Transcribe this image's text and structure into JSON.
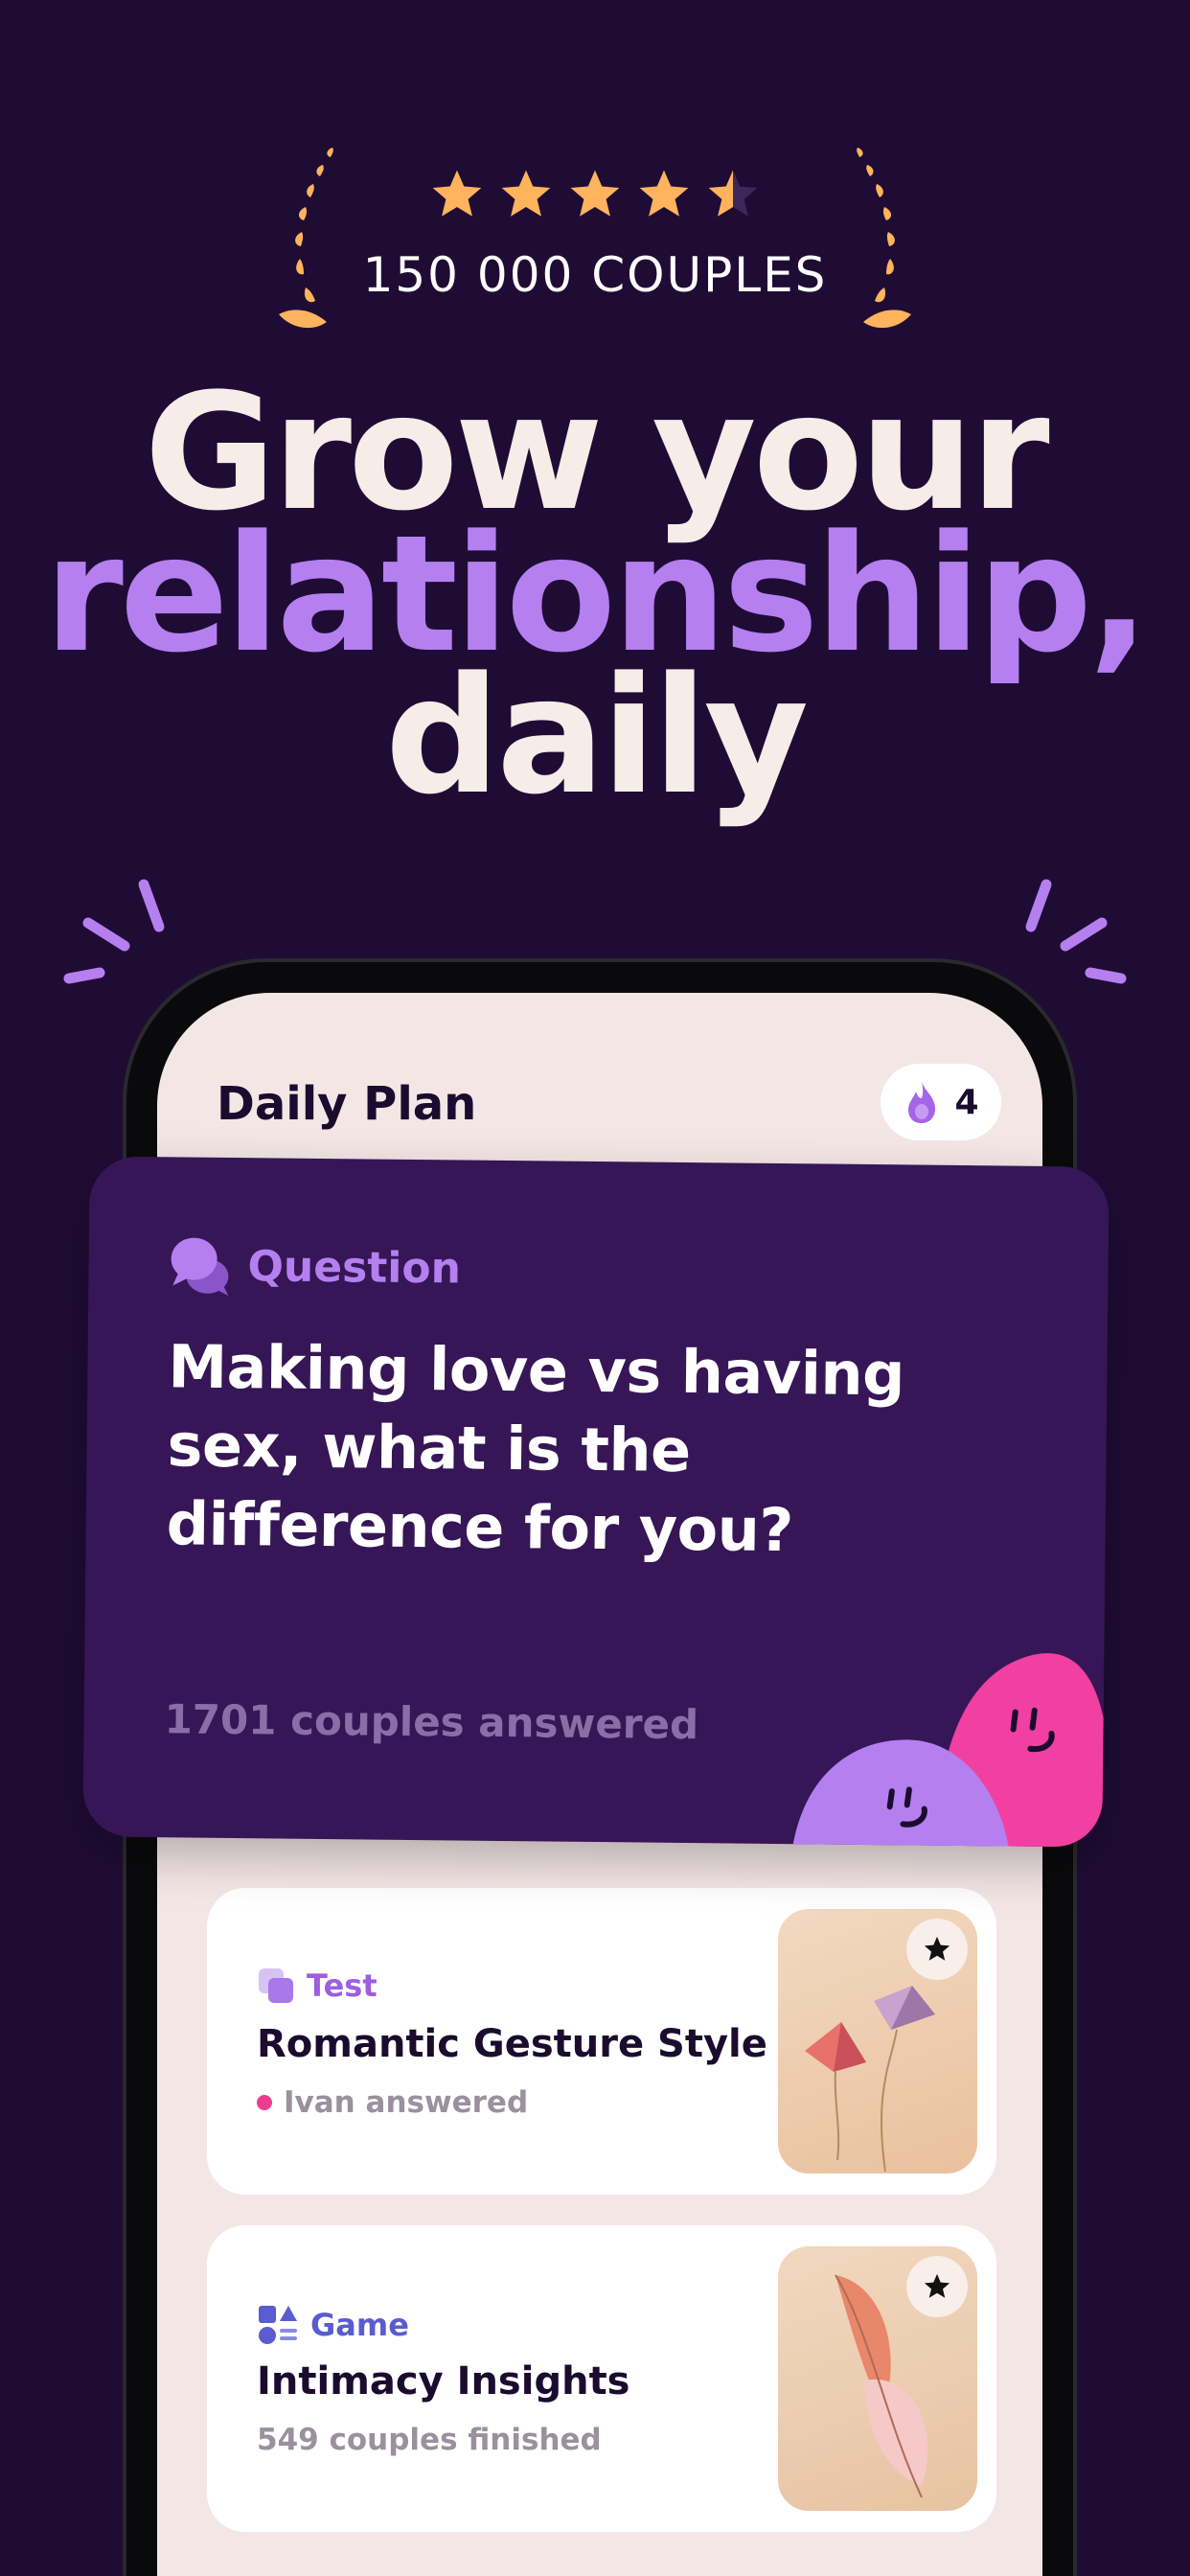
{
  "rating": {
    "stars_value": 4.5,
    "stars_max": 5,
    "count_text": "150 000 COUPLES",
    "star_color": "#ffb35c",
    "laurel_color": "#ffb35c"
  },
  "headline": {
    "line1": "Grow your",
    "line2": "relationship,",
    "line3": "daily",
    "accent_color": "#b57ff0"
  },
  "screen": {
    "title": "Daily Plan",
    "streak": {
      "icon": "flame-icon",
      "count": "4"
    }
  },
  "question_card": {
    "label": "Question",
    "icon": "chat-bubbles-icon",
    "text": "Making love vs having sex, what is the difference for you?",
    "answered": "1701 couples answered"
  },
  "cards": [
    {
      "tag": "Test",
      "tag_icon": "test-squares-icon",
      "tag_color": "#9b5fe0",
      "title": "Romantic Gesture Style",
      "status": "Ivan answered",
      "status_dot_color": "#ee3d8e",
      "image": "paper-kites",
      "fav_icon": "star-icon"
    },
    {
      "tag": "Game",
      "tag_icon": "shapes-icon",
      "tag_color": "#5b5ccf",
      "title": "Intimacy Insights",
      "status": "549 couples finished",
      "image": "pink-feather",
      "fav_icon": "star-icon"
    }
  ]
}
